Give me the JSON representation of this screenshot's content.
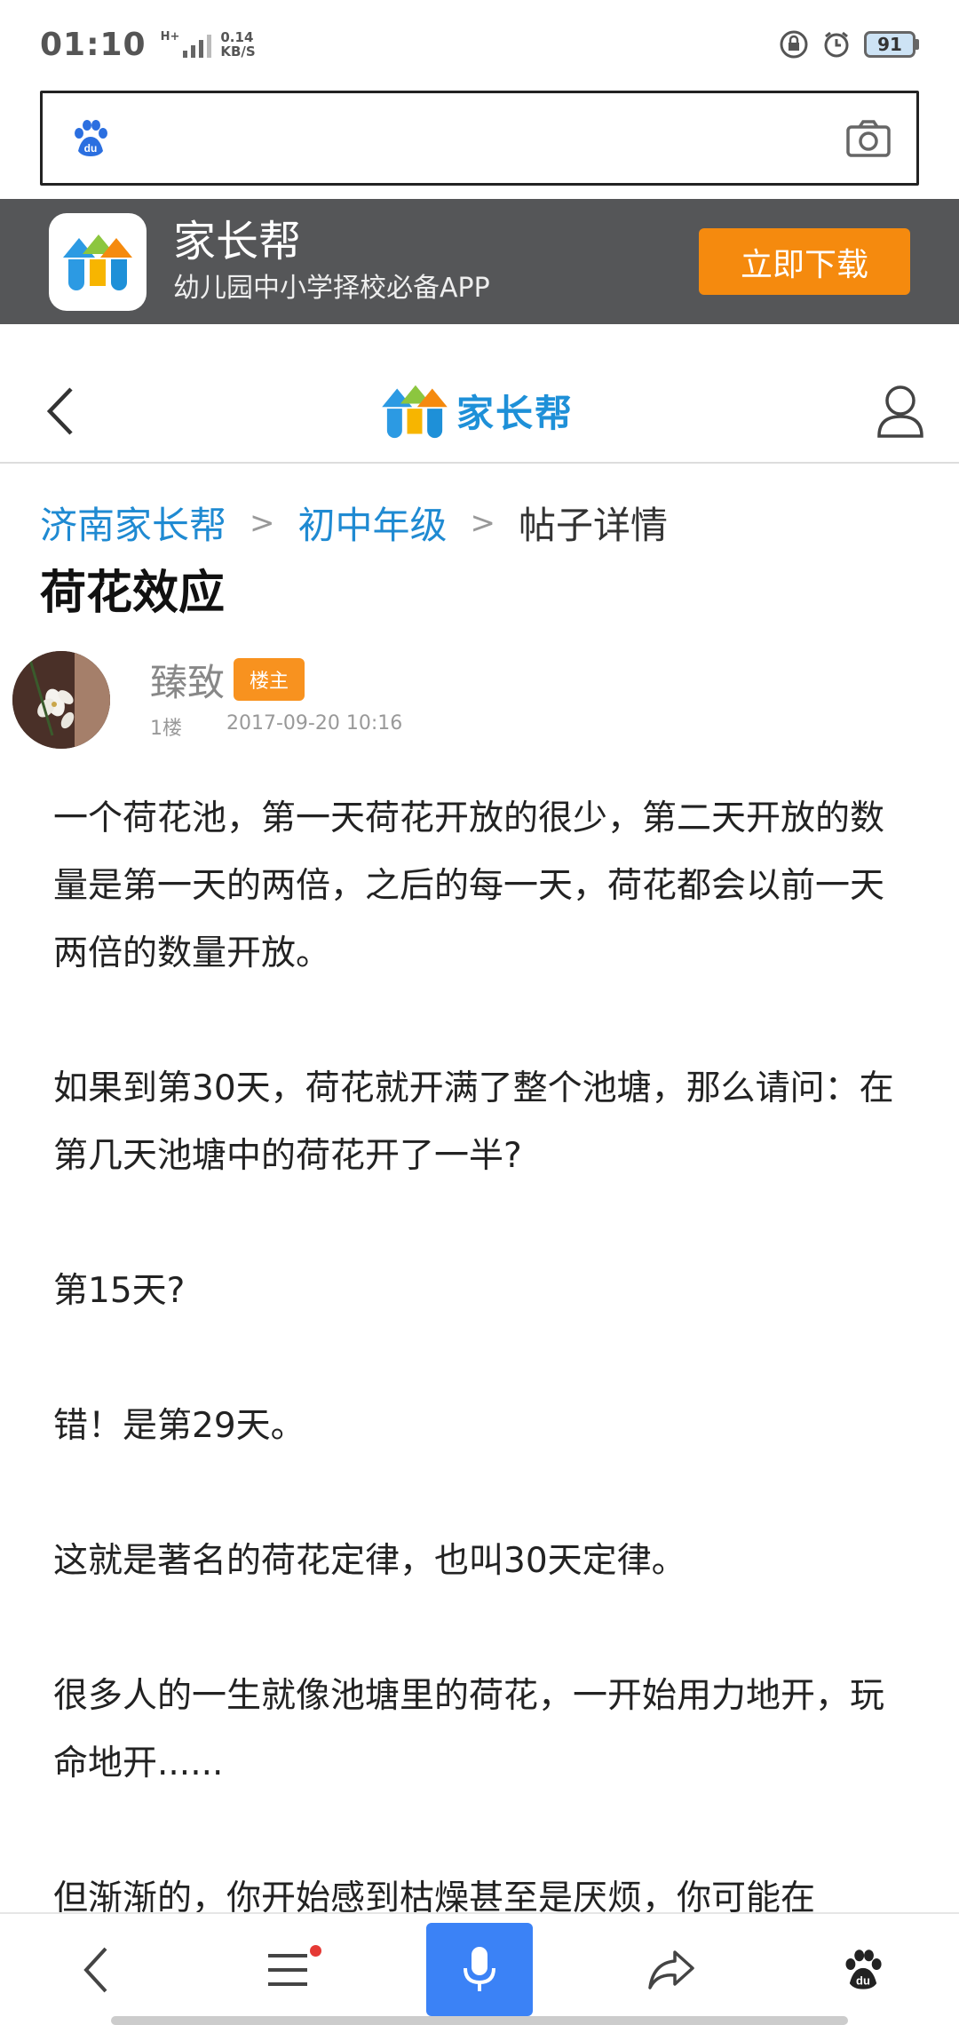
{
  "status_bar": {
    "time": "01:10",
    "network_type": "H+",
    "net_speed_value": "0.14",
    "net_speed_unit": "KB/S",
    "battery": "91"
  },
  "search": {
    "value": "",
    "placeholder": ""
  },
  "app_banner": {
    "name": "家长帮",
    "description": "幼儿园中小学择校必备APP",
    "download_label": "立即下载"
  },
  "header": {
    "logo_text": "家长帮"
  },
  "breadcrumb": {
    "items": [
      "济南家长帮",
      "初中年级",
      "帖子详情"
    ],
    "separator": ">"
  },
  "post": {
    "title": "荷花效应",
    "author": "臻致",
    "owner_badge": "楼主",
    "floor": "1楼",
    "timestamp": "2017-09-20 10:16",
    "paragraphs": [
      "一个荷花池，第一天荷花开放的很少，第二天开放的数量是第一天的两倍，之后的每一天，荷花都会以前一天两倍的数量开放。",
      "如果到第30天，荷花就开满了整个池塘，那么请问：在第几天池塘中的荷花开了一半?",
      "第15天?",
      "错！是第29天。",
      "这就是著名的荷花定律，也叫30天定律。",
      "很多人的一生就像池塘里的荷花，一开始用力地开，玩命地开......",
      "但渐渐的，你开始感到枯燥甚至是厌烦，你可能在"
    ]
  },
  "colors": {
    "link": "#1f8ad2",
    "banner_bg": "#555658",
    "download_btn": "#f58a0e",
    "owner_badge": "#f8921f",
    "voice_btn": "#3b82f6"
  },
  "icons": {
    "baidu": "baidu-paw-icon",
    "camera": "camera-icon",
    "back": "chevron-left-icon",
    "user": "user-icon",
    "menu": "menu-icon",
    "mic": "microphone-icon",
    "share": "share-icon"
  }
}
